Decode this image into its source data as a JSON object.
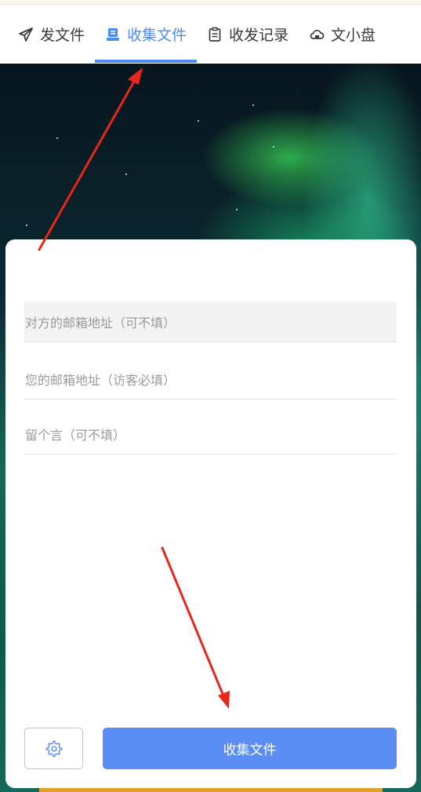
{
  "tabs": [
    {
      "label": "发文件",
      "icon": "send-icon"
    },
    {
      "label": "收集文件",
      "icon": "inbox-icon",
      "active": true
    },
    {
      "label": "收发记录",
      "icon": "clipboard-icon"
    },
    {
      "label": "文小盘",
      "icon": "cloud-lock-icon"
    }
  ],
  "form": {
    "recipient_email_placeholder": "对方的邮箱地址（可不填）",
    "your_email_placeholder": "您的邮箱地址（访客必填）",
    "message_placeholder": "留个言（可不填）"
  },
  "actions": {
    "settings_icon": "gear-icon",
    "submit_label": "收集文件"
  },
  "colors": {
    "accent": "#4d8cf5",
    "button": "#5b8ef5",
    "annotation_arrow": "#e8261c"
  }
}
